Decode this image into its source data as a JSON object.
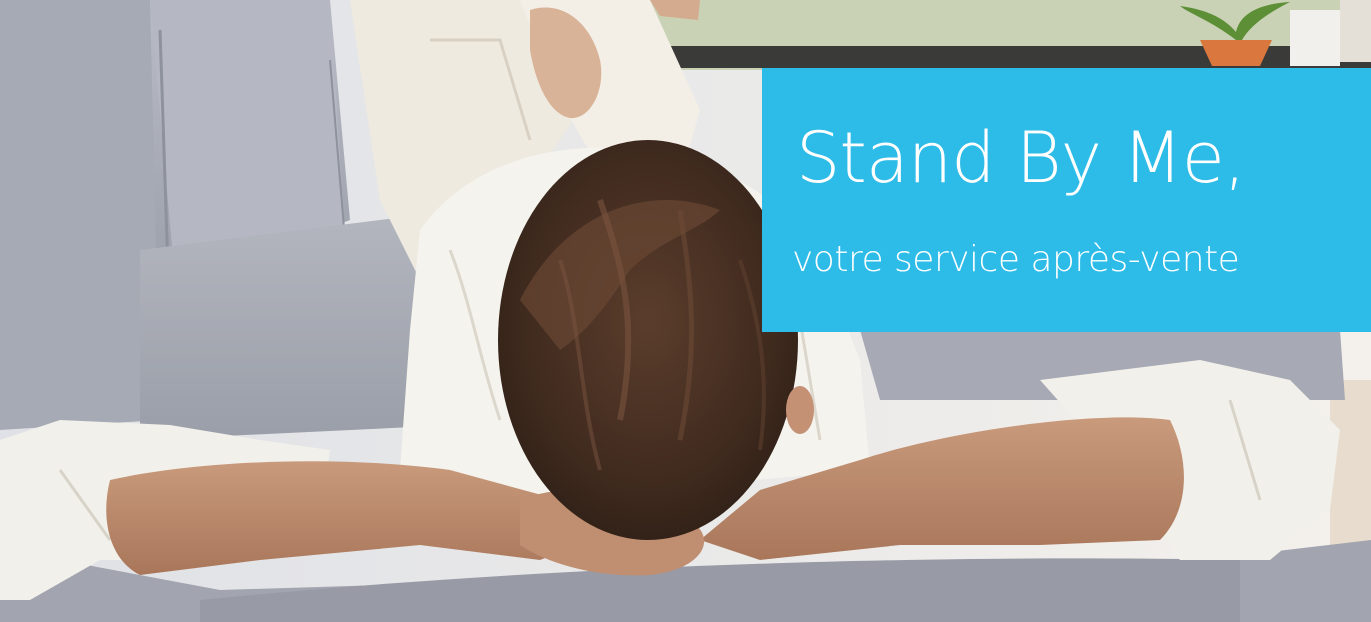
{
  "hero": {
    "title": "Stand By Me,",
    "subtitle": "votre service après-vente",
    "image": "man-relaxing-on-sofa-photo",
    "colors": {
      "panel": "#2dbbe8",
      "text": "#ffffff",
      "sofa": "#a9adb8",
      "background": "#eeeae6"
    }
  }
}
